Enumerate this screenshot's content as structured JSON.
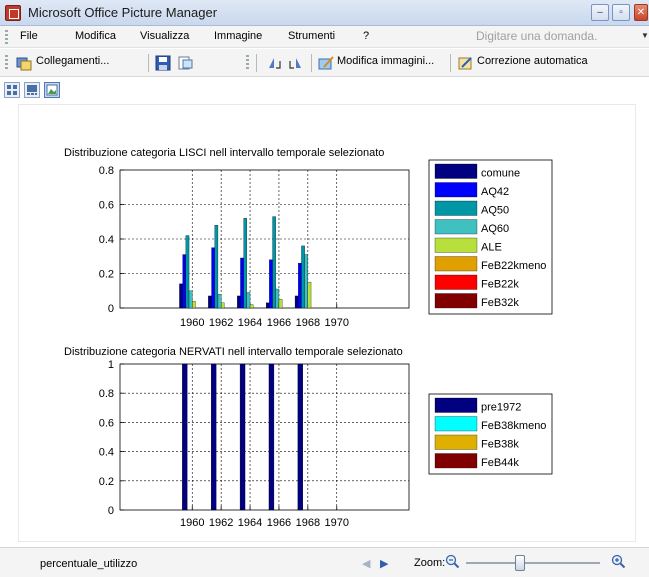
{
  "window": {
    "title": "Microsoft Office Picture Manager",
    "minimize": "‒",
    "maximize": "▫",
    "close": "✕"
  },
  "menu": {
    "items": [
      "File",
      "Modifica",
      "Visualizza",
      "Immagine",
      "Strumenti",
      "?"
    ],
    "help_placeholder": "Digitare una domanda."
  },
  "toolbar": {
    "shortcuts_label": "Collegamenti...",
    "edit_label": "Modifica immagini...",
    "autocorrect_label": "Correzione automatica"
  },
  "statusbar": {
    "filename": "percentuale_utilizzo",
    "zoom_label": "Zoom:"
  },
  "chart_data": [
    {
      "type": "bar",
      "title": "Distribuzione categoria LISCI nell intervallo temporale selezionato",
      "xlabel": "",
      "ylabel": "",
      "xlim": [
        1955,
        1975
      ],
      "x_ticks": [
        "1960",
        "1962",
        "1964",
        "1966",
        "1968",
        "1970"
      ],
      "ylim": [
        0,
        0.8
      ],
      "y_ticks": [
        "0",
        "0.2",
        "0.4",
        "0.6",
        "0.8"
      ],
      "grid": true,
      "legend_position": "right",
      "x": [
        1960,
        1962,
        1964,
        1966,
        1968
      ],
      "series": [
        {
          "name": "comune",
          "color": "#000080",
          "values": [
            0.14,
            0.07,
            0.07,
            0.03,
            0.07
          ]
        },
        {
          "name": "AQ42",
          "color": "#0000ff",
          "values": [
            0.31,
            0.35,
            0.29,
            0.28,
            0.26
          ]
        },
        {
          "name": "AQ50",
          "color": "#0096a6",
          "values": [
            0.42,
            0.48,
            0.52,
            0.53,
            0.36
          ]
        },
        {
          "name": "AQ60",
          "color": "#40c0c0",
          "values": [
            0.1,
            0.08,
            0.09,
            0.11,
            0.31
          ]
        },
        {
          "name": "ALE",
          "color": "#b8e03c",
          "values": [
            0.04,
            0.03,
            0.02,
            0.05,
            0.15
          ]
        },
        {
          "name": "FeB22kmeno",
          "color": "#e0a000",
          "values": [
            0.0,
            0.0,
            0.0,
            0.0,
            0.0
          ]
        },
        {
          "name": "FeB22k",
          "color": "#ff0000",
          "values": [
            0.0,
            0.0,
            0.0,
            0.0,
            0.0
          ]
        },
        {
          "name": "FeB32k",
          "color": "#800000",
          "values": [
            0.0,
            0.0,
            0.0,
            0.0,
            0.0
          ]
        }
      ]
    },
    {
      "type": "bar",
      "title": "Distribuzione categoria NERVATI nell intervallo temporale selezionato",
      "xlabel": "",
      "ylabel": "",
      "xlim": [
        1955,
        1975
      ],
      "x_ticks": [
        "1960",
        "1962",
        "1964",
        "1966",
        "1968",
        "1970"
      ],
      "ylim": [
        0,
        1
      ],
      "y_ticks": [
        "0",
        "0.2",
        "0.4",
        "0.6",
        "0.8",
        "1"
      ],
      "grid": true,
      "legend_position": "right",
      "x": [
        1960,
        1962,
        1964,
        1966,
        1968
      ],
      "series": [
        {
          "name": "pre1972",
          "color": "#000080",
          "values": [
            1,
            1,
            1,
            1,
            1
          ]
        },
        {
          "name": "FeB38kmeno",
          "color": "#00ffff",
          "values": [
            0,
            0,
            0,
            0,
            0
          ]
        },
        {
          "name": "FeB38k",
          "color": "#e0b000",
          "values": [
            0,
            0,
            0,
            0,
            0
          ]
        },
        {
          "name": "FeB44k",
          "color": "#800000",
          "values": [
            0,
            0,
            0,
            0,
            0
          ]
        }
      ]
    }
  ]
}
